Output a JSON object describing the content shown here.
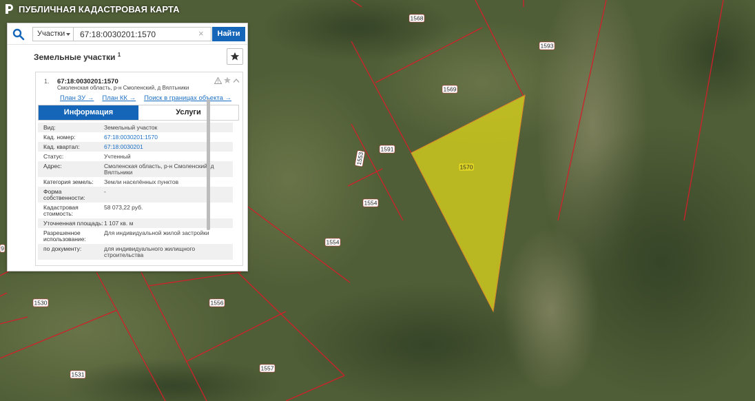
{
  "app": {
    "title": "ПУБЛИЧНАЯ КАДАСТРОВАЯ КАРТА"
  },
  "search": {
    "type_label": "Участки",
    "query_value": "67:18:0030201:1570",
    "clear_symbol": "×",
    "find_label": "Найти"
  },
  "panel": {
    "section_title": "Земельные участки",
    "section_count": "1"
  },
  "result": {
    "number": "1.",
    "cad_number": "67:18:0030201:1570",
    "address": "Смоленская область, р-н Смоленский, д Вялтьники",
    "links": [
      "План ЗУ →",
      "План КК →",
      "Поиск в границах объекта →"
    ],
    "tabs": [
      "Информация",
      "Услуги"
    ],
    "rows": [
      {
        "label": "Вид:",
        "value": "Земельный участок"
      },
      {
        "label": "Кад. номер:",
        "value": "67:18:0030201:1570"
      },
      {
        "label": "Кад. квартал:",
        "value": "67:18:0030201"
      },
      {
        "label": "Статус:",
        "value": "Учтенный"
      },
      {
        "label": "Адрес:",
        "value": "Смоленская область, р-н Смоленский, д Вялтьники"
      },
      {
        "label": "Категория земель:",
        "value": "Земли населённых пунктов"
      },
      {
        "label": "Форма собственности:",
        "value": "-"
      },
      {
        "label": "Кадастровая стоимость:",
        "value": "58 073,22 руб."
      },
      {
        "label": "Уточненная площадь:",
        "value": "1 107 кв. м"
      },
      {
        "label": "Разрешенное использование:",
        "value": "Для индивидуальной жилой застройки"
      },
      {
        "label": "по документу:",
        "value": "для индивидуального жилищного строительства"
      }
    ]
  },
  "map_labels": {
    "l1568": "1568",
    "l1593": "1593",
    "l1569": "1569",
    "l1591": "1591",
    "l1553": "1553",
    "l1570": "1570",
    "l1554a": "1554",
    "l1554b": "1554",
    "l1530": "1530",
    "l1556": "1556",
    "l1557": "1557",
    "l1531": "1531",
    "l9": "9"
  },
  "colors": {
    "accent": "#1565b8",
    "boundary": "#d0202a",
    "selected_fill": "#d9d21c",
    "link": "#1a6fc4"
  },
  "icons": [
    "logo-icon",
    "search-icon",
    "star-icon",
    "warning-icon",
    "chevron-up-icon",
    "close-icon"
  ]
}
